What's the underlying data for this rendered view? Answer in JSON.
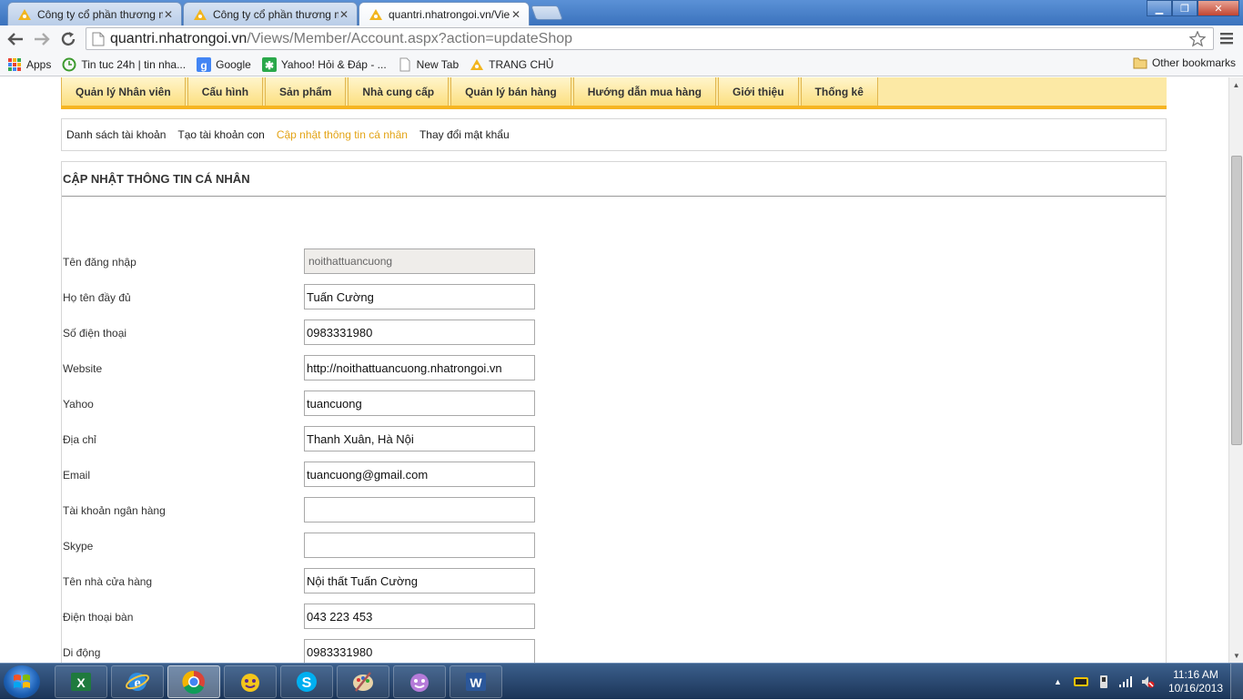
{
  "browser": {
    "tabs": [
      {
        "title": "Công ty cổ phần thương m",
        "active": false
      },
      {
        "title": "Công ty cổ phần thương m",
        "active": false
      },
      {
        "title": "quantri.nhatrongoi.vn/Vie",
        "active": true
      }
    ],
    "url_host": "quantri.nhatrongoi.vn",
    "url_path": "/Views/Member/Account.aspx?action=updateShop",
    "bookmarks": [
      {
        "label": "Apps",
        "icon": "apps-grid-icon"
      },
      {
        "label": "Tin tuc 24h | tin nha...",
        "icon": "clock-icon"
      },
      {
        "label": "Google",
        "icon": "google-icon"
      },
      {
        "label": "Yahoo! Hỏi & Đáp - ...",
        "icon": "yahoo-answers-icon"
      },
      {
        "label": "New Tab",
        "icon": "page-icon"
      },
      {
        "label": "TRANG CHỦ",
        "icon": "site-logo-icon"
      }
    ],
    "other_bookmarks": "Other bookmarks"
  },
  "main_menu": [
    "Quản lý Nhân viên",
    "Cấu hình",
    "Sản phẩm",
    "Nhà cung cấp",
    "Quản lý bán hàng",
    "Hướng dẫn mua hàng",
    "Giới thiệu",
    "Thống kê"
  ],
  "sub_menu": {
    "items": [
      "Danh sách tài khoản",
      "Tạo tài khoản con",
      "Cập nhật thông tin cá nhân",
      "Thay đổi mật khẩu"
    ],
    "active_index": 2
  },
  "panel_title": "CẬP NHẬT THÔNG TIN CÁ NHÂN",
  "form": {
    "fields": [
      {
        "label": "Tên đăng nhập",
        "value": "noithattuancuong",
        "readonly": true
      },
      {
        "label": "Họ tên đầy đủ",
        "value": "Tuấn Cường"
      },
      {
        "label": "Số điện thoại",
        "value": "0983331980"
      },
      {
        "label": "Website",
        "value": "http://noithattuancuong.nhatrongoi.vn"
      },
      {
        "label": "Yahoo",
        "value": "tuancuong"
      },
      {
        "label": "Địa chỉ",
        "value": "Thanh Xuân, Hà Nội"
      },
      {
        "label": "Email",
        "value": "tuancuong@gmail.com"
      },
      {
        "label": "Tài khoản ngân hàng",
        "value": ""
      },
      {
        "label": "Skype",
        "value": ""
      },
      {
        "label": "Tên nhà cửa hàng",
        "value": "Nội thất Tuấn Cường"
      },
      {
        "label": "Điện thoại bàn",
        "value": "043 223 453"
      },
      {
        "label": "Di động",
        "value": "0983331980"
      }
    ]
  },
  "taskbar": {
    "apps": [
      "excel-icon",
      "internet-explorer-icon",
      "chrome-icon",
      "yahoo-messenger-icon",
      "skype-icon",
      "paint-icon",
      "yahoo-messenger-icon",
      "word-icon"
    ],
    "time": "11:16 AM",
    "date": "10/16/2013"
  },
  "colors": {
    "menu_bg": "#fce9a5",
    "menu_border": "#f6b522",
    "submenu_active": "#e3a417"
  }
}
